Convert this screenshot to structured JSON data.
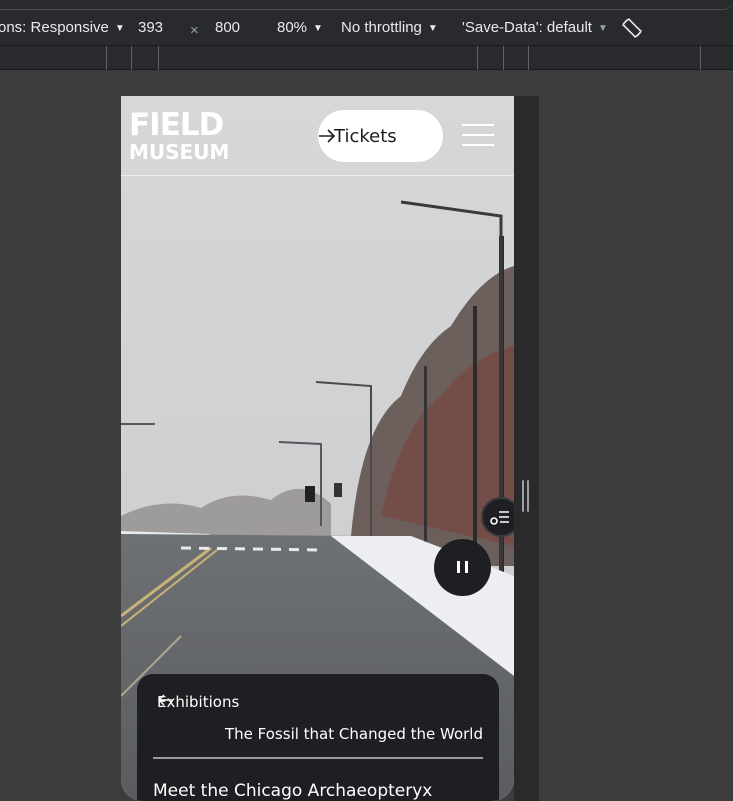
{
  "devtools": {
    "dimensions_label": "ons: Responsive",
    "width": "393",
    "times": "×",
    "height": "800",
    "zoom": "80%",
    "throttling": "No throttling",
    "save_data": "'Save-Data': default",
    "caret": "▼",
    "rotate_icon": "rotate-icon"
  },
  "site": {
    "logo_line1": "FIELD",
    "logo_line2": "MUSEUM",
    "tickets_label": "Tickets",
    "menu_icon": "hamburger-menu-icon",
    "transcript_icon": "transcript-icon",
    "pause_icon": "pause-icon"
  },
  "card": {
    "back_label": "Exhibitions",
    "subtitle": "The Fossil that Changed the World",
    "title": "Meet the Chicago Archaeopteryx"
  },
  "colors": {
    "devtools_bg": "#292a2d",
    "page_bg": "#3c3c3c",
    "card_bg": "#1e1f22",
    "accent_white": "#ffffff"
  }
}
